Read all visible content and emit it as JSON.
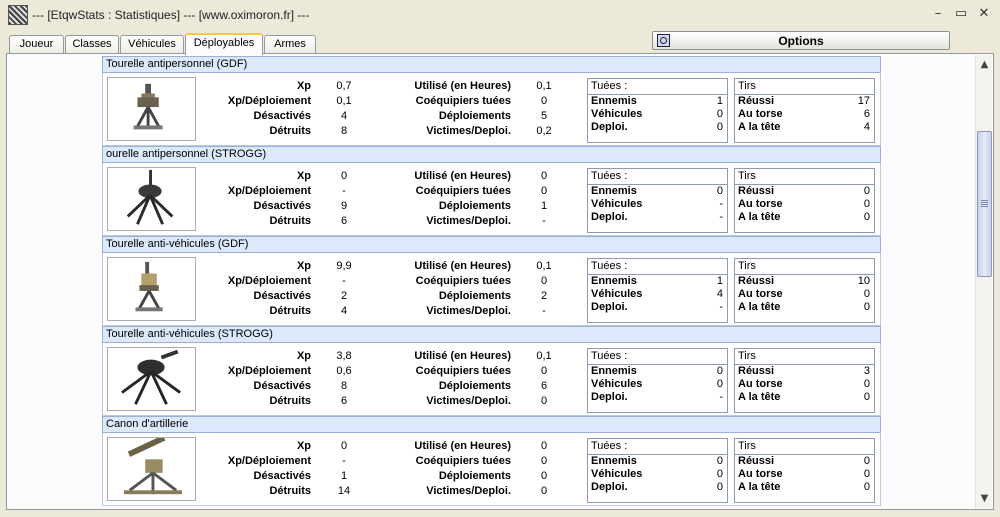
{
  "window": {
    "title": "--- [EtqwStats : Statistiques] --- [www.oximoron.fr] ---",
    "minimize": "–",
    "maximize": "▭",
    "close": "✕"
  },
  "tabs": [
    {
      "label": "Joueur",
      "active": false
    },
    {
      "label": "Classes",
      "active": false
    },
    {
      "label": "Véhicules",
      "active": false
    },
    {
      "label": "Déployables",
      "active": true
    },
    {
      "label": "Armes",
      "active": false
    }
  ],
  "options_label": "Options",
  "labels": {
    "xp": "Xp",
    "xp_deploy": "Xp/Déploiement",
    "disabled": "Désactivés",
    "destroyed": "Détruits",
    "used_hours": "Utilisé (en Heures)",
    "team_kills": "Coéquipiers tuées",
    "deployments": "Déploiements",
    "victims_deploy": "Victimes/Deploi.",
    "kills_title": "Tuées :",
    "enemies": "Ennemis",
    "vehicles": "Véhicules",
    "deploy": "Deploi.",
    "shots_title": "Tirs",
    "hits": "Réussi",
    "torso": "Au torse",
    "head": "A la tête"
  },
  "deployables": [
    {
      "name": "Tourelle antipersonnel (GDF)",
      "icon": "gdf-antipersonnel-turret-image",
      "xp": "0,7",
      "xp_deploy": "0,1",
      "disabled": "4",
      "destroyed": "8",
      "used_hours": "0,1",
      "team_kills": "0",
      "deployments": "5",
      "victims_deploy": "0,2",
      "kills": {
        "enemies": "1",
        "vehicles": "0",
        "deploy": "0"
      },
      "shots": {
        "hits": "17",
        "torso": "6",
        "head": "4"
      }
    },
    {
      "name": "ourelle antipersonnel (STROGG)",
      "icon": "strogg-antipersonnel-turret-image",
      "xp": "0",
      "xp_deploy": "-",
      "disabled": "9",
      "destroyed": "6",
      "used_hours": "0",
      "team_kills": "0",
      "deployments": "1",
      "victims_deploy": "-",
      "kills": {
        "enemies": "0",
        "vehicles": "-",
        "deploy": "-"
      },
      "shots": {
        "hits": "0",
        "torso": "0",
        "head": "0"
      }
    },
    {
      "name": "Tourelle anti-véhicules (GDF)",
      "icon": "gdf-antivehicle-turret-image",
      "xp": "9,9",
      "xp_deploy": "-",
      "disabled": "2",
      "destroyed": "4",
      "used_hours": "0,1",
      "team_kills": "0",
      "deployments": "2",
      "victims_deploy": "-",
      "kills": {
        "enemies": "1",
        "vehicles": "4",
        "deploy": "-"
      },
      "shots": {
        "hits": "10",
        "torso": "0",
        "head": "0"
      }
    },
    {
      "name": "Tourelle anti-véhicules (STROGG)",
      "icon": "strogg-antivehicle-turret-image",
      "xp": "3,8",
      "xp_deploy": "0,6",
      "disabled": "8",
      "destroyed": "6",
      "used_hours": "0,1",
      "team_kills": "0",
      "deployments": "6",
      "victims_deploy": "0",
      "kills": {
        "enemies": "0",
        "vehicles": "0",
        "deploy": "-"
      },
      "shots": {
        "hits": "3",
        "torso": "0",
        "head": "0"
      }
    },
    {
      "name": "Canon d'artillerie",
      "icon": "artillery-cannon-image",
      "xp": "0",
      "xp_deploy": "-",
      "disabled": "1",
      "destroyed": "14",
      "used_hours": "0",
      "team_kills": "0",
      "deployments": "0",
      "victims_deploy": "0",
      "kills": {
        "enemies": "0",
        "vehicles": "0",
        "deploy": "0"
      },
      "shots": {
        "hits": "0",
        "torso": "0",
        "head": "0"
      }
    }
  ]
}
